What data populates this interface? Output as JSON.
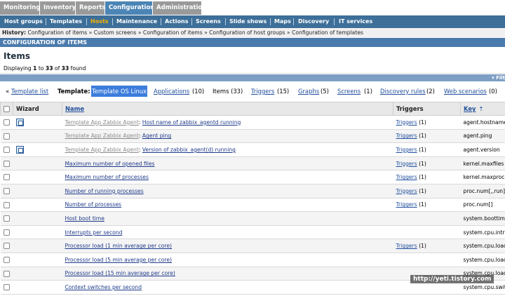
{
  "top_menu": [
    {
      "label": "Monitoring",
      "active": false
    },
    {
      "label": "Inventory",
      "active": false
    },
    {
      "label": "Reports",
      "active": false
    },
    {
      "label": "Configuration",
      "active": true
    },
    {
      "label": "Administration",
      "active": false
    }
  ],
  "sub_menu": [
    {
      "label": "Host groups",
      "active": false
    },
    {
      "label": "Templates",
      "active": false
    },
    {
      "label": "Hosts",
      "active": true
    },
    {
      "label": "Maintenance",
      "active": false
    },
    {
      "label": "Actions",
      "active": false
    },
    {
      "label": "Screens",
      "active": false
    },
    {
      "label": "Slide shows",
      "active": false
    },
    {
      "label": "Maps",
      "active": false
    },
    {
      "label": "Discovery",
      "active": false
    },
    {
      "label": "IT services",
      "active": false
    }
  ],
  "history": {
    "label": "History:",
    "trail": "Configuration of items » Custom screens » Configuration of items » Configuration of host groups » Configuration of templates"
  },
  "section_title": "CONFIGURATION OF ITEMS",
  "items_title": "Items",
  "displaying": {
    "prefix": "Displaying",
    "from": "1",
    "to_word": "to",
    "to": "33",
    "of_word": "of",
    "total": "33",
    "suffix": "found"
  },
  "filter_label": "Filt",
  "nav": {
    "template_list": "Template list",
    "template_label": "Template:",
    "template_name": "Template OS Linux",
    "applications": "Applications",
    "applications_count": "(10)",
    "items": "Items (33)",
    "triggers": "Triggers",
    "triggers_count": "(15)",
    "graphs": "Graphs",
    "graphs_count": "(5)",
    "screens": "Screens",
    "screens_count": "(1)",
    "discovery": "Discovery rules",
    "discovery_count": "(2)",
    "web": "Web scenarios",
    "web_count": "(0)"
  },
  "table": {
    "headers": {
      "wizard": "Wizard",
      "name": "Name",
      "triggers": "Triggers",
      "key": "Key"
    },
    "rows": [
      {
        "wizard": true,
        "template": "Template App Zabbix Agent",
        "name": "Host name of zabbix_agentd running",
        "triggers": "Triggers",
        "trig_count": "(1)",
        "key": "agent.hostname"
      },
      {
        "wizard": false,
        "template": "Template App Zabbix Agent",
        "name": "Agent ping",
        "triggers": "Triggers",
        "trig_count": "(1)",
        "key": "agent.ping"
      },
      {
        "wizard": true,
        "template": "Template App Zabbix Agent",
        "name": "Version of zabbix_agent(d) running",
        "triggers": "Triggers",
        "trig_count": "(1)",
        "key": "agent.version"
      },
      {
        "wizard": false,
        "template": "",
        "name": "Maximum number of opened files",
        "triggers": "Triggers",
        "trig_count": "(1)",
        "key": "kernel.maxfiles"
      },
      {
        "wizard": false,
        "template": "",
        "name": "Maximum number of processes",
        "triggers": "Triggers",
        "trig_count": "(1)",
        "key": "kernel.maxproc"
      },
      {
        "wizard": false,
        "template": "",
        "name": "Number of running processes",
        "triggers": "Triggers",
        "trig_count": "(1)",
        "key": "proc.num[,,run]"
      },
      {
        "wizard": false,
        "template": "",
        "name": "Number of processes",
        "triggers": "Triggers",
        "trig_count": "(1)",
        "key": "proc.num[]"
      },
      {
        "wizard": false,
        "template": "",
        "name": "Host boot time",
        "triggers": "",
        "trig_count": "",
        "key": "system.boottime"
      },
      {
        "wizard": false,
        "template": "",
        "name": "Interrupts per second",
        "triggers": "",
        "trig_count": "",
        "key": "system.cpu.intr"
      },
      {
        "wizard": false,
        "template": "",
        "name": "Processor load (1 min average per core)",
        "triggers": "Triggers",
        "trig_count": "(1)",
        "key": "system.cpu.load"
      },
      {
        "wizard": false,
        "template": "",
        "name": "Processor load (5 min average per core)",
        "triggers": "",
        "trig_count": "",
        "key": "system.cpu.load"
      },
      {
        "wizard": false,
        "template": "",
        "name": "Processor load (15 min average per core)",
        "triggers": "",
        "trig_count": "",
        "key": "system.cpu.load"
      },
      {
        "wizard": false,
        "template": "",
        "name": "Context switches per second",
        "triggers": "",
        "trig_count": "",
        "key": "system.cpu.switches"
      }
    ]
  },
  "watermark": "http://yeti.tistory.com"
}
